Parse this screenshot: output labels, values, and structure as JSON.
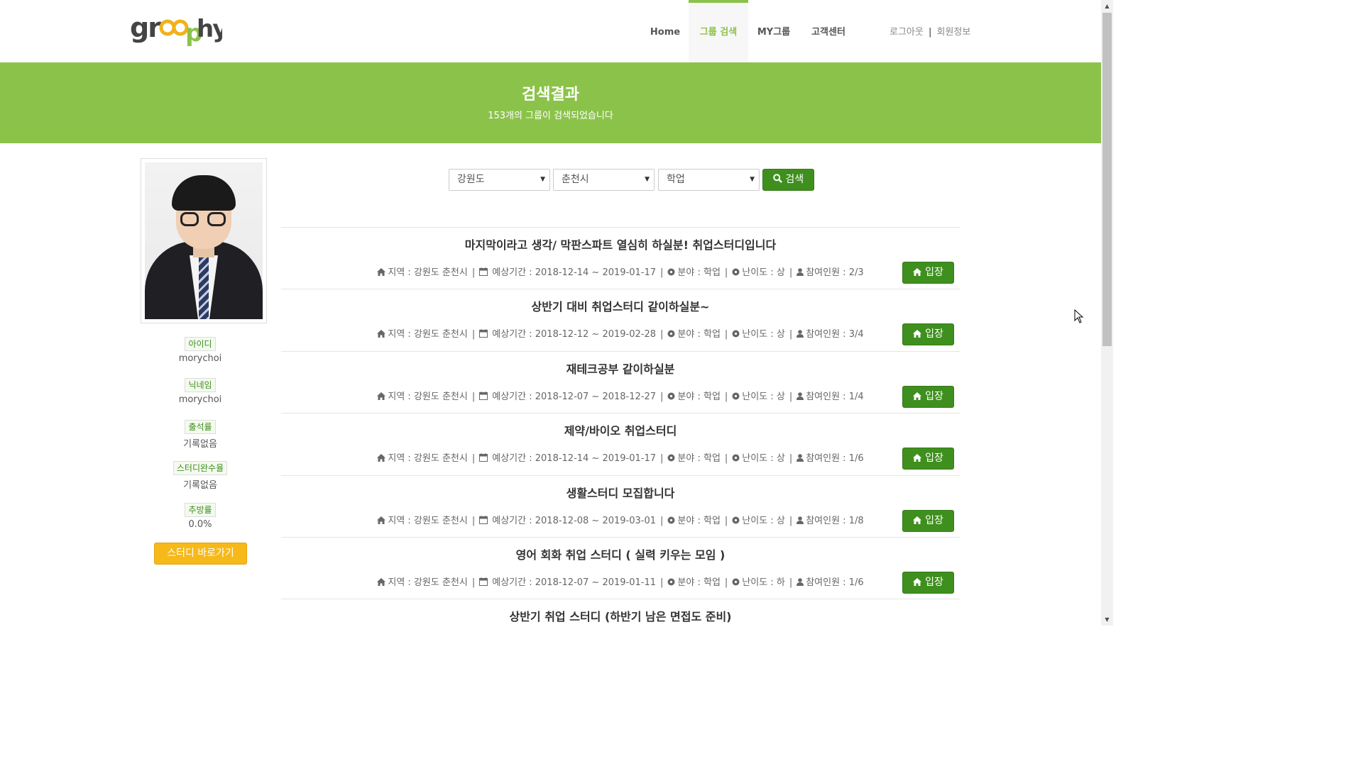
{
  "header": {
    "logo_text": "groophy",
    "nav": [
      {
        "label": "Home"
      },
      {
        "label": "그룹 검색"
      },
      {
        "label": "MY그룹"
      },
      {
        "label": "고객센터"
      }
    ],
    "logout": "로그아웃",
    "separator": "|",
    "member_info": "회원정보"
  },
  "banner": {
    "title": "검색결과",
    "subtitle": "153개의 그룹이 검색되었습니다"
  },
  "profile": {
    "fields": [
      {
        "label": "아이디",
        "value": "morychoi"
      },
      {
        "label": "닉네임",
        "value": "morychoi"
      },
      {
        "label": "출석률",
        "value": "기록없음"
      },
      {
        "label": "스터디완수율",
        "value": "기록없음"
      },
      {
        "label": "추방률",
        "value": "0.0%"
      }
    ],
    "study_button": "스터디 바로가기"
  },
  "search": {
    "region": "강원도",
    "city": "춘천시",
    "category": "학업",
    "button": "검색"
  },
  "meta_labels": {
    "region": "지역 :",
    "period": "예상기간 :",
    "field": "분야 :",
    "difficulty": "난이도 :",
    "members": "참여인원 :"
  },
  "groups": [
    {
      "title": "마지막이라고 생각/ 막판스파트 열심히 하실분! 취업스터디입니다",
      "region": "강원도 춘천시",
      "period": "2018-12-14 ~ 2019-01-17",
      "field": "학업",
      "difficulty": "상",
      "members": "2/3"
    },
    {
      "title": "상반기 대비 취업스터디 같이하실분~",
      "region": "강원도 춘천시",
      "period": "2018-12-12 ~ 2019-02-28",
      "field": "학업",
      "difficulty": "상",
      "members": "3/4"
    },
    {
      "title": "재테크공부 같이하실분",
      "region": "강원도 춘천시",
      "period": "2018-12-07 ~ 2018-12-27",
      "field": "학업",
      "difficulty": "상",
      "members": "1/4"
    },
    {
      "title": "제약/바이오 취업스터디",
      "region": "강원도 춘천시",
      "period": "2018-12-14 ~ 2019-01-17",
      "field": "학업",
      "difficulty": "상",
      "members": "1/6"
    },
    {
      "title": "생활스터디 모집합니다",
      "region": "강원도 춘천시",
      "period": "2018-12-08 ~ 2019-03-01",
      "field": "학업",
      "difficulty": "상",
      "members": "1/8"
    },
    {
      "title": "영어 회화 취업 스터디 ( 실력 키우는 모임 )",
      "region": "강원도 춘천시",
      "period": "2018-12-07 ~ 2019-01-11",
      "field": "학업",
      "difficulty": "하",
      "members": "1/6"
    },
    {
      "title": "상반기 취업 스터디 (하반기 남은 면접도 준비)",
      "region": "",
      "period": "",
      "field": "",
      "difficulty": "",
      "members": ""
    }
  ],
  "enter_button": "입장",
  "icons": {
    "home": "home-icon",
    "calendar": "calendar-icon",
    "field": "gear-icon",
    "difficulty": "gear-icon",
    "user": "user-icon",
    "search": "search-icon"
  },
  "colors": {
    "brand_green": "#8bc34a",
    "button_green": "#3f8f1e",
    "button_yellow": "#f6b919"
  }
}
